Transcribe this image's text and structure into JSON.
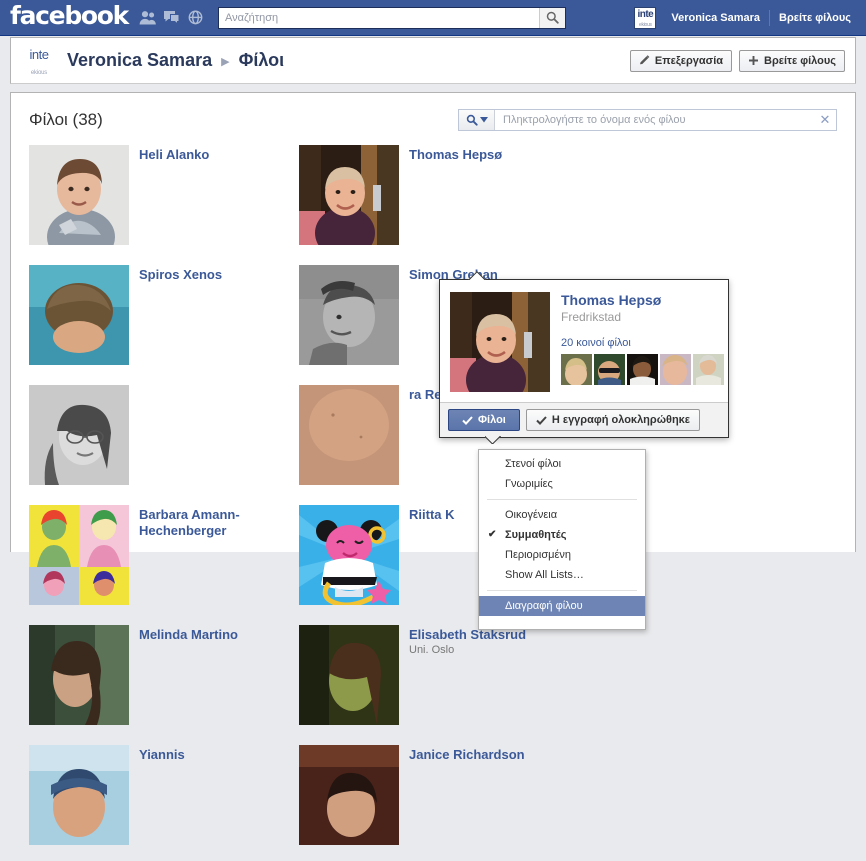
{
  "topbar": {
    "logo": "facebook",
    "icons": [
      {
        "name": "friends-icon",
        "label": "Friend requests"
      },
      {
        "name": "messages-icon",
        "label": "Messages"
      },
      {
        "name": "notifications-icon",
        "label": "Notifications"
      }
    ],
    "search": {
      "placeholder": "Αναζήτηση",
      "value": "",
      "button_icon": "search-icon"
    },
    "profile_thumb": {
      "line1": "inte",
      "line2": "ekious"
    },
    "profile_name": "Veronica Samara",
    "find_friends": "Βρείτε φίλους",
    "bg_color": "#3b5998"
  },
  "subheader": {
    "thumb": {
      "line1": "inte",
      "line2": "ekious"
    },
    "profile_name": "Veronica Samara",
    "separator": "▶",
    "section": "Φίλοι",
    "edit_button": "Επεξεργασία",
    "edit_icon": "pencil-icon",
    "find_friends_button": "Βρείτε φίλους",
    "find_friends_icon": "plus-icon"
  },
  "content": {
    "title": "Φίλοι (38)",
    "friend_search": {
      "placeholder": "Πληκτρολογήστε το όνομα ενός φίλου",
      "value": "",
      "search_icon": "search-icon",
      "dropdown_icon": "caret-down-icon",
      "clear_icon": "close-icon"
    },
    "friends": [
      {
        "name": "Heli Alanko",
        "sub": ""
      },
      {
        "name": "Thomas Hepsø",
        "sub": ""
      },
      {
        "name": "Spiros Xenos",
        "sub": ""
      },
      {
        "name": "Simon Grehan",
        "sub": ""
      },
      {
        "name": "",
        "sub": ""
      },
      {
        "name": "ra Rennert",
        "sub": ""
      },
      {
        "name": "Barbara Amann-Hechenberger",
        "sub": ""
      },
      {
        "name": "Riitta K",
        "sub": ""
      },
      {
        "name": "Melinda Martino",
        "sub": ""
      },
      {
        "name": "Elisabeth Staksrud",
        "sub": "Uni. Oslo"
      },
      {
        "name": "Yiannis",
        "sub": ""
      },
      {
        "name": "Janice Richardson",
        "sub": ""
      }
    ]
  },
  "hovercard": {
    "name": "Thomas Hepsø",
    "location": "Fredrikstad",
    "mutual_friends": "20 κοινοί φίλοι",
    "mutual_count": 5,
    "friend_button": {
      "label": "Φίλοι",
      "icon": "check-icon",
      "active": true
    },
    "subscribed_button": {
      "label": "Η εγγραφή ολοκληρώθηκε",
      "icon": "check-icon"
    }
  },
  "dropdown": {
    "items": [
      {
        "label": "Στενοί φίλοι",
        "checked": false,
        "selected": false,
        "separator_after": false
      },
      {
        "label": "Γνωριμίες",
        "checked": false,
        "selected": false,
        "separator_after": true
      },
      {
        "label": "Οικογένεια",
        "checked": false,
        "selected": false,
        "separator_after": false
      },
      {
        "label": "Συμμαθητές",
        "checked": true,
        "selected": false,
        "separator_after": false
      },
      {
        "label": "Περιορισμένη",
        "checked": false,
        "selected": false,
        "separator_after": false
      },
      {
        "label": "Show All Lists…",
        "checked": false,
        "selected": false,
        "separator_after": true
      },
      {
        "label": "Διαγραφή φίλου",
        "checked": false,
        "selected": true,
        "separator_after": false
      }
    ],
    "highlight_color": "#6d84b4"
  }
}
